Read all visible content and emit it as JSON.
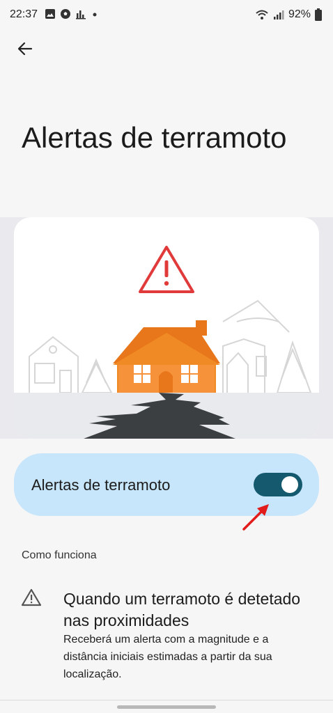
{
  "status_bar": {
    "time": "22:37",
    "battery": "92%",
    "icons": [
      "gallery-icon",
      "soccer-ball-icon",
      "stats-icon",
      "dot-icon",
      "wifi-icon",
      "signal-icon",
      "battery-icon"
    ]
  },
  "header": {
    "back_icon": "arrow-left-icon"
  },
  "page": {
    "title": "Alertas de terramoto"
  },
  "illustration": {
    "colors": {
      "house": "#f08a24",
      "house_roof": "#e8761a",
      "warning": "#e03a3a",
      "ground": "#e8eaed",
      "crack": "#3c3f42"
    }
  },
  "toggle": {
    "label": "Alertas de terramoto",
    "state": "on"
  },
  "how_it_works": {
    "heading": "Como funciona",
    "items": [
      {
        "icon": "warning-triangle-icon",
        "title": "Quando um terramoto é detetado nas proximidades",
        "description": "Receberá um alerta com a magnitude e a distância iniciais estimadas a partir da sua localização."
      }
    ]
  }
}
